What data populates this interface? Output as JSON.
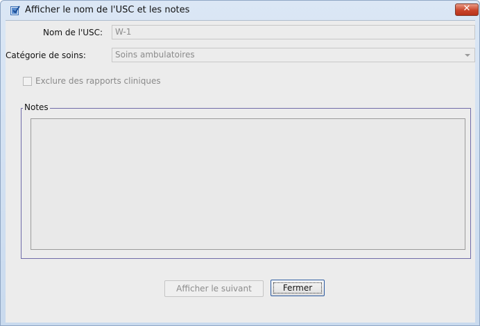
{
  "window": {
    "title": "Afficher le nom de l'USC et les notes",
    "accent": "#c9452b"
  },
  "form": {
    "name_label": "Nom de l'USC:",
    "name_value": "W-1",
    "category_label": "Catégorie de soins:",
    "category_value": "Soins ambulatoires",
    "exclude_label": "Exclure des rapports cliniques",
    "exclude_checked": false,
    "notes_legend": "Notes",
    "notes_value": ""
  },
  "buttons": {
    "next_label": "Afficher le suivant",
    "close_label": "Fermer"
  },
  "icons": {
    "app": "dialog-icon",
    "close": "close-icon",
    "dropdown": "chevron-down-icon"
  }
}
